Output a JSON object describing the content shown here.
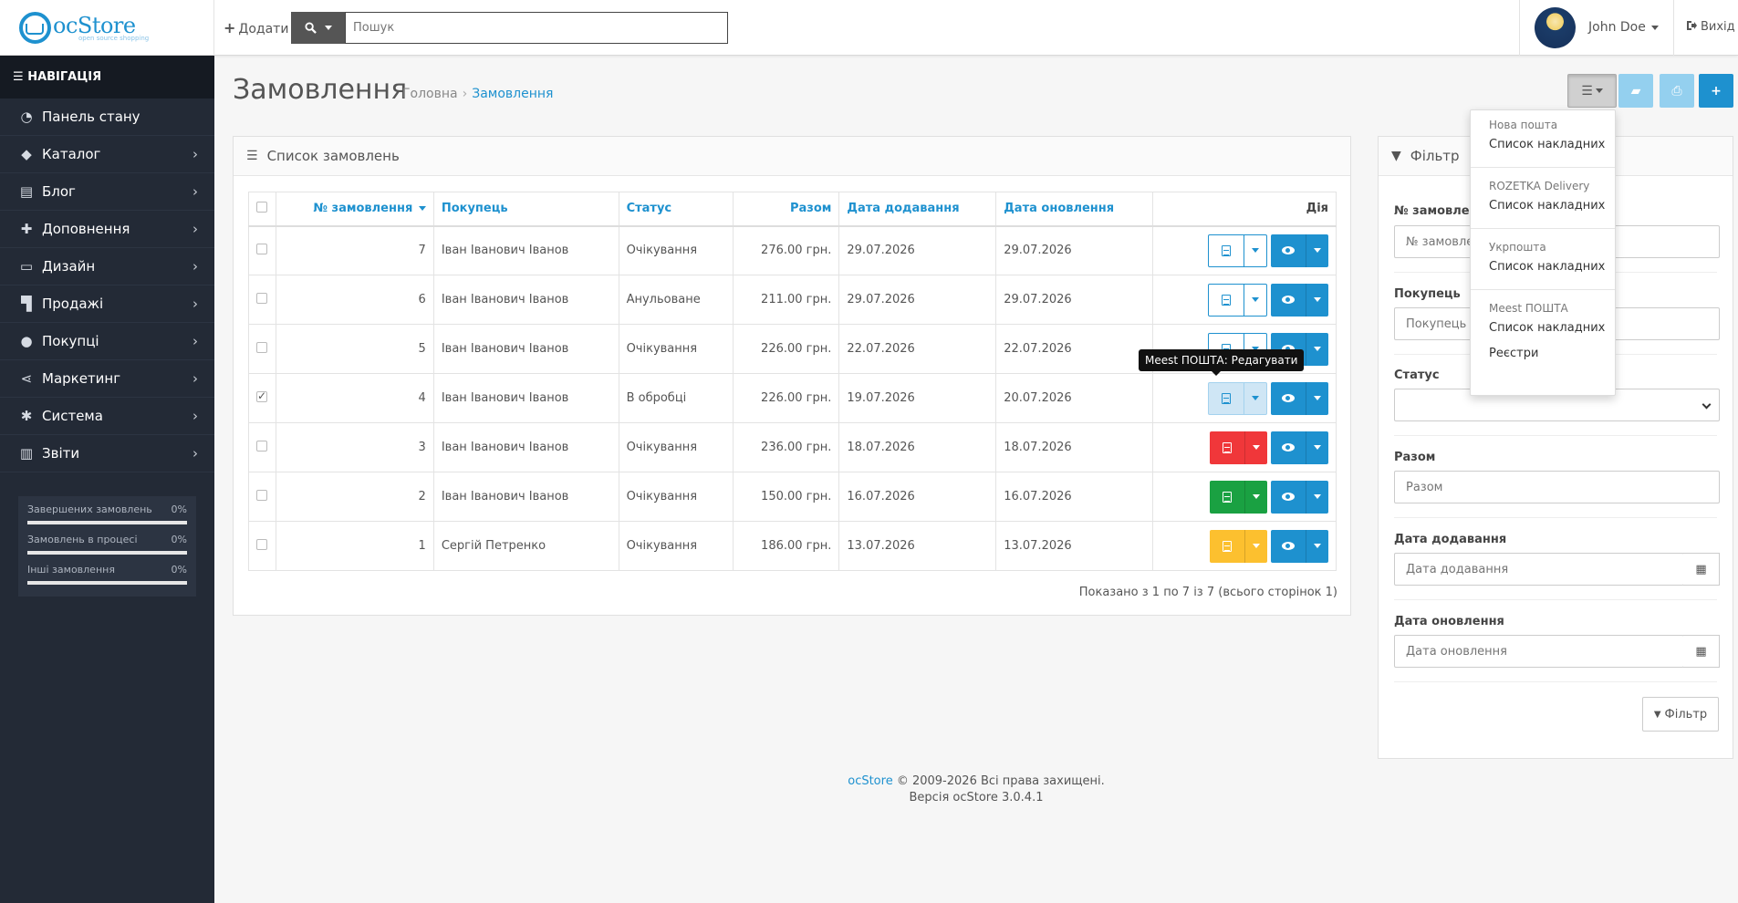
{
  "header": {
    "logo_text": "ocStore",
    "logo_sub": "open source shopping",
    "add_label": "Додати",
    "search_placeholder": "Пошук",
    "username": "John Doe",
    "logout_label": "Вихід"
  },
  "sidebar": {
    "nav_title": "НАВІГАЦІЯ",
    "items": [
      {
        "label": "Панель стану",
        "icon": "dashboard-icon"
      },
      {
        "label": "Каталог",
        "icon": "tags-icon"
      },
      {
        "label": "Блог",
        "icon": "book-icon"
      },
      {
        "label": "Доповнення",
        "icon": "puzzle-icon"
      },
      {
        "label": "Дизайн",
        "icon": "monitor-icon"
      },
      {
        "label": "Продажі",
        "icon": "cart-icon"
      },
      {
        "label": "Покупці",
        "icon": "user-icon"
      },
      {
        "label": "Маркетинг",
        "icon": "share-icon"
      },
      {
        "label": "Система",
        "icon": "gear-icon"
      },
      {
        "label": "Звіти",
        "icon": "bar-chart-icon"
      }
    ],
    "stats": [
      {
        "label": "Завершених замовлень",
        "value": "0%"
      },
      {
        "label": "Замовлень в процесі",
        "value": "0%"
      },
      {
        "label": "Інші замовлення",
        "value": "0%"
      }
    ]
  },
  "page": {
    "title": "Замовлення",
    "breadcrumb_home": "Головна",
    "breadcrumb_current": "Замовлення"
  },
  "dropdown": {
    "groups": [
      {
        "title": "Нова пошта",
        "items": [
          "Список накладних"
        ]
      },
      {
        "title": "ROZETKA Delivery",
        "items": [
          "Список накладних"
        ]
      },
      {
        "title": "Укрпошта",
        "items": [
          "Список накладних"
        ]
      },
      {
        "title": "Meest ПОШТА",
        "items": [
          "Список накладних",
          "Реєстри"
        ]
      }
    ]
  },
  "orders": {
    "panel_title": "Список замовлень",
    "columns": {
      "id": "№ замовлення",
      "customer": "Покупець",
      "status": "Статус",
      "total": "Разом",
      "date_added": "Дата додавання",
      "date_modified": "Дата оновлення",
      "action": "Дія"
    },
    "rows": [
      {
        "id": "7",
        "customer": "Іван Іванович Іванов",
        "status": "Очікування",
        "total": "276.00 грн.",
        "date_added": "29.07.2026",
        "date_modified": "29.07.2026",
        "checked": false,
        "doc_style": "outline"
      },
      {
        "id": "6",
        "customer": "Іван Іванович Іванов",
        "status": "Анульоване",
        "total": "211.00 грн.",
        "date_added": "29.07.2026",
        "date_modified": "29.07.2026",
        "checked": false,
        "doc_style": "outline"
      },
      {
        "id": "5",
        "customer": "Іван Іванович Іванов",
        "status": "Очікування",
        "total": "226.00 грн.",
        "date_added": "22.07.2026",
        "date_modified": "22.07.2026",
        "checked": false,
        "doc_style": "outline"
      },
      {
        "id": "4",
        "customer": "Іван Іванович Іванов",
        "status": "В обробці",
        "total": "226.00 грн.",
        "date_added": "19.07.2026",
        "date_modified": "20.07.2026",
        "checked": true,
        "doc_style": "hover"
      },
      {
        "id": "3",
        "customer": "Іван Іванович Іванов",
        "status": "Очікування",
        "total": "236.00 грн.",
        "date_added": "18.07.2026",
        "date_modified": "18.07.2026",
        "checked": false,
        "doc_style": "red"
      },
      {
        "id": "2",
        "customer": "Іван Іванович Іванов",
        "status": "Очікування",
        "total": "150.00 грн.",
        "date_added": "16.07.2026",
        "date_modified": "16.07.2026",
        "checked": false,
        "doc_style": "green"
      },
      {
        "id": "1",
        "customer": "Сергій Петренко",
        "status": "Очікування",
        "total": "186.00 грн.",
        "date_added": "13.07.2026",
        "date_modified": "13.07.2026",
        "checked": false,
        "doc_style": "yellow"
      }
    ],
    "pager_text": "Показано з 1 по 7 із 7 (всього сторінок 1)",
    "tooltip": "Meest ПОШТА: Редагувати"
  },
  "filter": {
    "title": "Фільтр",
    "order_id_label": "№ замовлення",
    "order_id_placeholder": "№ замовлення",
    "customer_label": "Покупець",
    "customer_placeholder": "Покупець",
    "status_label": "Статус",
    "total_label": "Разом",
    "total_placeholder": "Разом",
    "date_added_label": "Дата додавання",
    "date_added_placeholder": "Дата додавання",
    "date_modified_label": "Дата оновлення",
    "date_modified_placeholder": "Дата оновлення",
    "button_label": "Фільтр"
  },
  "footer": {
    "link": "ocStore",
    "copyright": "© 2009-2026 Всі права захищені.",
    "version": "Версія ocStore 3.0.4.1"
  },
  "colors": {
    "primary": "#1e91cf",
    "sidebar": "#232a36",
    "danger": "#f0373a",
    "success": "#1aa142",
    "warning": "#fcc02f"
  }
}
